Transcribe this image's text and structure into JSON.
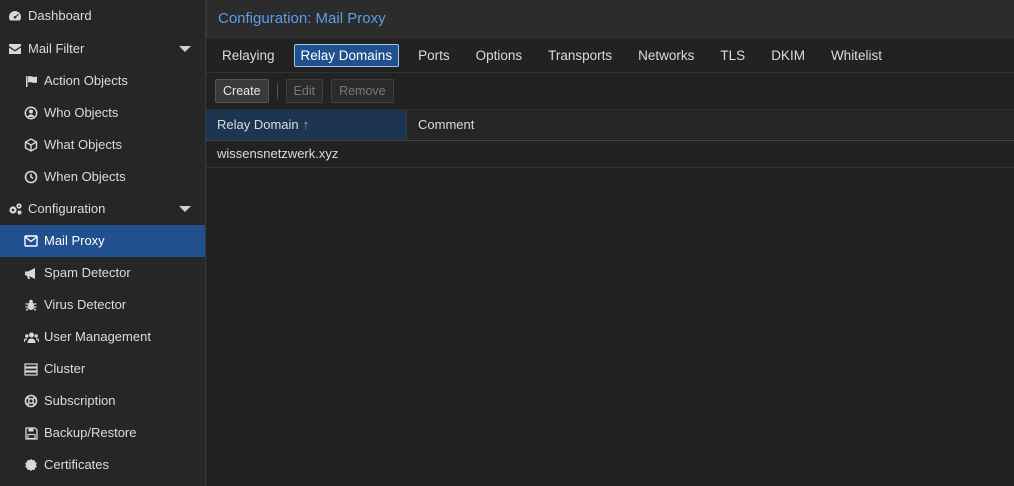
{
  "title": "Configuration: Mail Proxy",
  "sidebar": {
    "items": [
      {
        "label": "Dashboard",
        "icon": "dashboard-icon"
      },
      {
        "label": "Mail Filter",
        "icon": "envelope-icon"
      },
      {
        "label": "Action Objects",
        "icon": "flag-icon"
      },
      {
        "label": "Who Objects",
        "icon": "user-circle-icon"
      },
      {
        "label": "What Objects",
        "icon": "cube-icon"
      },
      {
        "label": "When Objects",
        "icon": "clock-icon"
      },
      {
        "label": "Configuration",
        "icon": "gears-icon"
      },
      {
        "label": "Mail Proxy",
        "icon": "envelope-outline-icon"
      },
      {
        "label": "Spam Detector",
        "icon": "bullhorn-icon"
      },
      {
        "label": "Virus Detector",
        "icon": "bug-icon"
      },
      {
        "label": "User Management",
        "icon": "users-icon"
      },
      {
        "label": "Cluster",
        "icon": "server-icon"
      },
      {
        "label": "Subscription",
        "icon": "life-ring-icon"
      },
      {
        "label": "Backup/Restore",
        "icon": "floppy-icon"
      },
      {
        "label": "Certificates",
        "icon": "certificate-icon"
      }
    ]
  },
  "tabs": [
    "Relaying",
    "Relay Domains",
    "Ports",
    "Options",
    "Transports",
    "Networks",
    "TLS",
    "DKIM",
    "Whitelist"
  ],
  "active_tab": "Relay Domains",
  "toolbar": {
    "create": "Create",
    "edit": "Edit",
    "remove": "Remove"
  },
  "grid": {
    "columns": [
      "Relay Domain",
      "Comment"
    ],
    "sort_arrow": "↑",
    "rows": [
      {
        "domain": "wissensnetzwerk.xyz",
        "comment": ""
      }
    ]
  },
  "colors": {
    "accent": "#21508f",
    "title": "#5d9ee6"
  }
}
